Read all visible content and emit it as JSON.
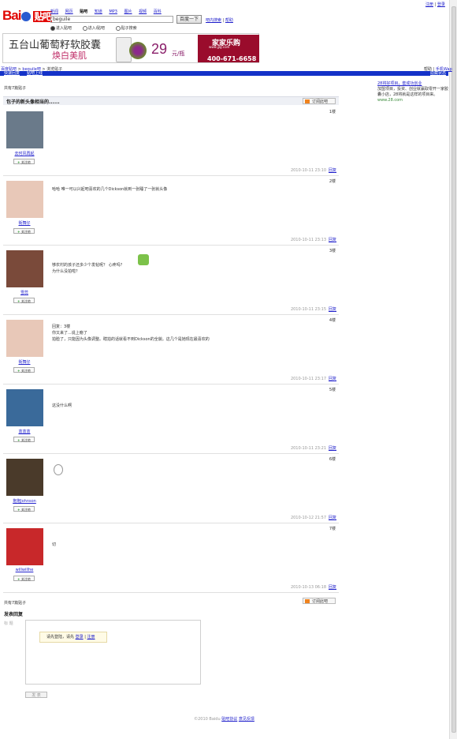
{
  "header": {
    "logo_text": "Bai",
    "logo_tieba": "贴吧",
    "nav": [
      "新闻",
      "网页",
      "贴吧",
      "知道",
      "MP3",
      "图片",
      "视频",
      "百科"
    ],
    "nav_current_index": 2,
    "search_value": "beguile",
    "search_button": "百度一下",
    "search_links": [
      "吧内搜索",
      "帮助"
    ],
    "search_options": [
      "进入贴吧",
      "进入i贴吧",
      "贴子搜索"
    ],
    "top_links": [
      "注册",
      "登录"
    ]
  },
  "ad": {
    "line1": "五台山葡萄籽软胶囊",
    "line2": "焕白美肌",
    "price": "29",
    "unit": "元/瓶",
    "brand": "家家乐购",
    "brand_sub": "www.jjlg.com",
    "phone": "400-671-6658"
  },
  "breadcrumb": {
    "home": "百度贴吧",
    "forum": "beguile吧",
    "current": "浏览贴子",
    "right_label": "帮助",
    "right_link": "手机Wap"
  },
  "bluebar": {
    "left1": "快速回复",
    "left2": "贴吧上线",
    "right": "隐藏状态"
  },
  "thread": {
    "count_text": "共有7篇贴子",
    "title": "包子的新头像相当的......",
    "rss_label": "订阅此吧",
    "follow_label": "关注他",
    "reply_label": "回复"
  },
  "posts": [
    {
      "user": "去时风再起",
      "floor": "1楼",
      "date": "2010-10-11 23:10",
      "lines": [],
      "avatar_color": "#6a7a8a"
    },
    {
      "user": "街舞仔",
      "floor": "2楼",
      "date": "2010-10-11 23:13",
      "lines": [
        "哈哈  唯一可以兴起吧喜欢的几个Dickson就到一张睡了一张就头像"
      ],
      "avatar_color": "#e8c8b8"
    },
    {
      "user": "雪蕊",
      "floor": "3楼",
      "date": "2010-10-11 23:15",
      "lines": [
        "够农村的孩子还多少个发帖呢？ 心疼吗？",
        "为什么没拍啦？"
      ],
      "avatar_color": "#7a4a3a"
    },
    {
      "user": "街舞仔",
      "floor": "4楼",
      "date": "2010-10-11 23:17",
      "lines": [
        "回复：3楼",
        "你又来了...说上瘾了",
        "拍脸了，只能因为头像调整。瞎拍的话就看不到Dickson的全貌。这几个是她现在最喜欢的"
      ],
      "avatar_color": "#e8c8b8"
    },
    {
      "user": "蓝蓝蓝",
      "floor": "5楼",
      "date": "2010-10-11 23:21",
      "lines": [
        "这没什么啊"
      ],
      "avatar_color": "#3a6a9a"
    },
    {
      "user": "抱抱Johnson",
      "floor": "6楼",
      "date": "2010-10-12 21:57",
      "lines": [],
      "avatar_color": "#4a3a2a"
    },
    {
      "user": "willwillhe",
      "floor": "7楼",
      "date": "2010-10-13 06:18",
      "lines": [
        "切"
      ],
      "avatar_color": "#c8282a"
    }
  ],
  "sidebar": {
    "title": "28将好项目，套成功创业",
    "text": "加盟项目，投资、创业就赢取零开一家胶囊小店，28将就是这样的项目来。",
    "url": "www.28.com"
  },
  "reply": {
    "count_text": "共有7篇贴子",
    "title": "发表回复",
    "grey_text": "标  题",
    "tip_text": "请先登陆，请先",
    "tip_login": "登录",
    "tip_sep": "|",
    "tip_register": "注册",
    "post_button": "发 表"
  },
  "footer": {
    "copyright": "©2010 Baidu",
    "link1": "贴吧协议",
    "link2": "意见反馈"
  }
}
